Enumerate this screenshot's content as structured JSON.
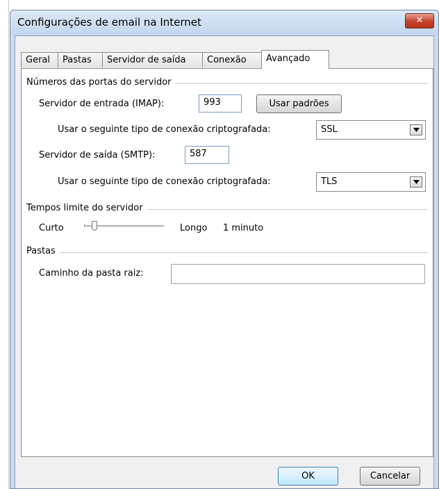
{
  "window": {
    "title": "Configurações de email na Internet",
    "close_label": "✕"
  },
  "tabs": [
    {
      "label": "Geral",
      "active": false
    },
    {
      "label": "Pastas",
      "active": false
    },
    {
      "label": "Servidor de saída",
      "active": false
    },
    {
      "label": "Conexão",
      "active": false
    },
    {
      "label": "Avançado",
      "active": true
    }
  ],
  "ports": {
    "group_title": "Números das portas do servidor",
    "incoming_label": "Servidor de entrada (IMAP):",
    "incoming_value": "993",
    "defaults_button": "Usar padrões",
    "incoming_encryption_label": "Usar o seguinte tipo de conexão criptografada:",
    "incoming_encryption_value": "SSL",
    "outgoing_label": "Servidor de saída (SMTP):",
    "outgoing_value": "587",
    "outgoing_encryption_label": "Usar o seguinte tipo de conexão criptografada:",
    "outgoing_encryption_value": "TLS"
  },
  "timeouts": {
    "group_title": "Tempos limite do servidor",
    "short_label": "Curto",
    "long_label": "Longo",
    "value_label": "1 minuto",
    "slider_level": 0.08
  },
  "folders": {
    "group_title": "Pastas",
    "root_path_label": "Caminho da pasta raiz:",
    "root_path_value": ""
  },
  "footer": {
    "ok_label": "OK",
    "cancel_label": "Cancelar"
  }
}
